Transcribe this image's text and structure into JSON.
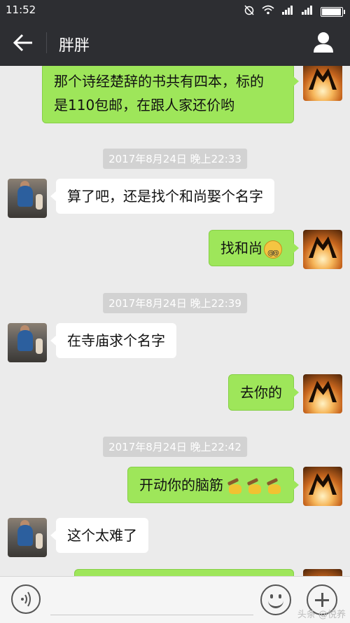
{
  "status_bar": {
    "time": "11:52",
    "battery_level": 0.9,
    "icons": [
      "alarm-off-icon",
      "wifi-icon",
      "signal-icon",
      "signal-icon",
      "battery-icon"
    ]
  },
  "header": {
    "back_icon": "arrow-left-icon",
    "title": "胖胖",
    "profile_icon": "person-icon"
  },
  "colors": {
    "header_bg": "#2d2e32",
    "chat_bg": "#ebebeb",
    "sent_bubble": "#9ee65a",
    "received_bubble": "#ffffff",
    "timestamp_bg": "#d2d2d2"
  },
  "messages": [
    {
      "type": "text",
      "side": "right",
      "lines": [
        "那个诗经楚辞的书共有四本，标的",
        "是110包邮，在跟人家还价哟"
      ]
    },
    {
      "type": "timestamp",
      "text": "2017年8月24日 晚上22:33"
    },
    {
      "type": "text",
      "side": "left",
      "text": "算了吧，还是找个和尚娶个名字"
    },
    {
      "type": "text",
      "side": "right",
      "text": "找和尚",
      "emoji": [
        "dizzy-face-emoji"
      ]
    },
    {
      "type": "timestamp",
      "text": "2017年8月24日 晚上22:39"
    },
    {
      "type": "text",
      "side": "left",
      "text": "在寺庙求个名字"
    },
    {
      "type": "text",
      "side": "right",
      "text": "去你的"
    },
    {
      "type": "timestamp",
      "text": "2017年8月24日 晚上22:42"
    },
    {
      "type": "text",
      "side": "right",
      "text": "开动你的脑筋",
      "emoji": [
        "hammer-emoji",
        "hammer-emoji",
        "hammer-emoji"
      ]
    },
    {
      "type": "text",
      "side": "left",
      "text": "这个太难了"
    }
  ],
  "input_bar": {
    "voice_icon": "voice-icon",
    "emoji_icon": "smiley-icon",
    "plus_icon": "plus-icon",
    "value": "",
    "watermark": "头条 @悦养"
  }
}
